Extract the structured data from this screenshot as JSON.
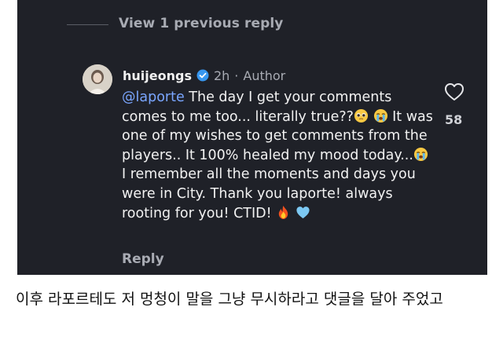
{
  "thread": {
    "view_previous_label": "View 1 previous reply"
  },
  "comment": {
    "username": "huijeongs",
    "verified_icon": "verified-badge-icon",
    "time": "2h",
    "separator": "·",
    "role": "Author",
    "mention": "@laporte",
    "text_part1": " The day I get your comments comes to me too... literally true??",
    "text_part2": " It was one of my wishes to get comments from the players.. It 100% healed my mood today...",
    "text_part3": " I remember all the moments and days you were in City. Thank you laporte! always rooting for you! CTID! ",
    "emojis": [
      "pleading-face-icon",
      "loudly-crying-face-icon",
      "loudly-crying-face-icon",
      "fire-icon",
      "light-blue-heart-icon"
    ],
    "reply_label": "Reply",
    "like_icon": "heart-outline-icon",
    "like_count": "58"
  },
  "caption": {
    "text": "이후 라포르테도 저 멍청이 말을 그냥 무시하라고 댓글을 달아 주었고"
  },
  "colors": {
    "background": "#1f2128",
    "mention": "#7aa6ff",
    "verified": "#3797f0",
    "muted": "#a8abb3"
  }
}
